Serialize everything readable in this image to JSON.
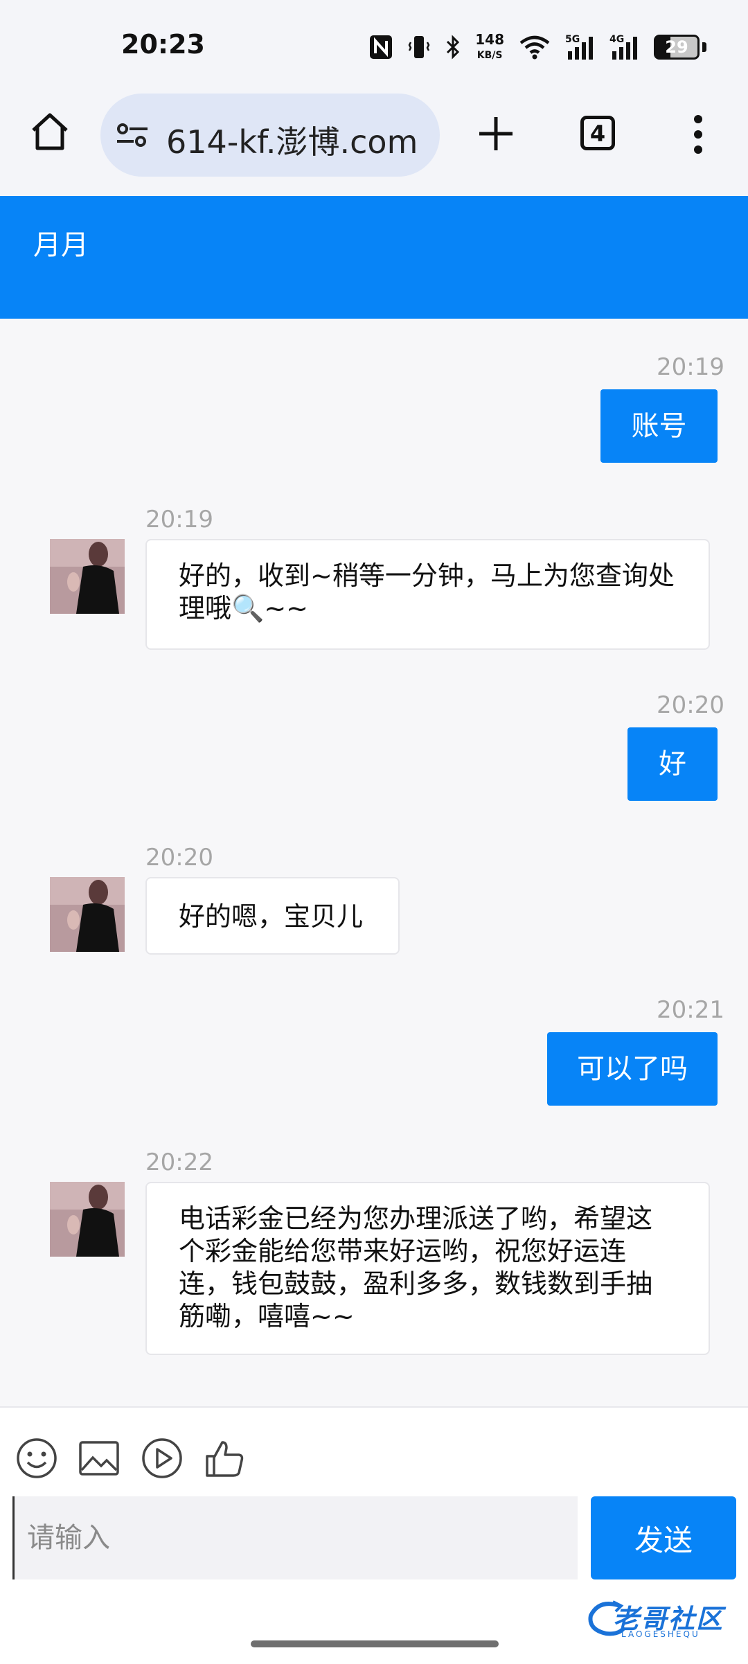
{
  "status_bar": {
    "time": "20:23",
    "net_speed_value": "148",
    "net_speed_unit": "KB/S",
    "signal_1_label": "5G",
    "signal_2_label": "4G",
    "battery": "29"
  },
  "browser": {
    "url": "614-kf.澎博.com",
    "tab_count": "4"
  },
  "chat": {
    "title": "月月",
    "messages": [
      {
        "side": "out",
        "time": "20:19",
        "text": "账号"
      },
      {
        "side": "in",
        "time": "20:19",
        "text": "好的，收到~稍等一分钟，马上为您查询处理哦🔍~~"
      },
      {
        "side": "out",
        "time": "20:20",
        "text": "好"
      },
      {
        "side": "in",
        "time": "20:20",
        "text": "好的嗯，宝贝儿"
      },
      {
        "side": "out",
        "time": "20:21",
        "text": "可以了吗"
      },
      {
        "side": "in",
        "time": "20:22",
        "text": "电话彩金已经为您办理派送了哟，希望这个彩金能给您带来好运哟，祝您好运连连，钱包鼓鼓，盈利多多，数钱数到手抽筋嘞，嘻嘻~~"
      }
    ]
  },
  "composer": {
    "placeholder": "请输入",
    "send_label": "发送",
    "tools": [
      "emoji-icon",
      "image-icon",
      "video-icon",
      "thumbs-up-icon"
    ]
  },
  "watermark": {
    "text": "老哥社区",
    "sub": "LAOGESHEQU"
  },
  "colors": {
    "accent": "#0784f7",
    "background": "#f7f7f9",
    "timestamp": "#a6a6a6"
  }
}
